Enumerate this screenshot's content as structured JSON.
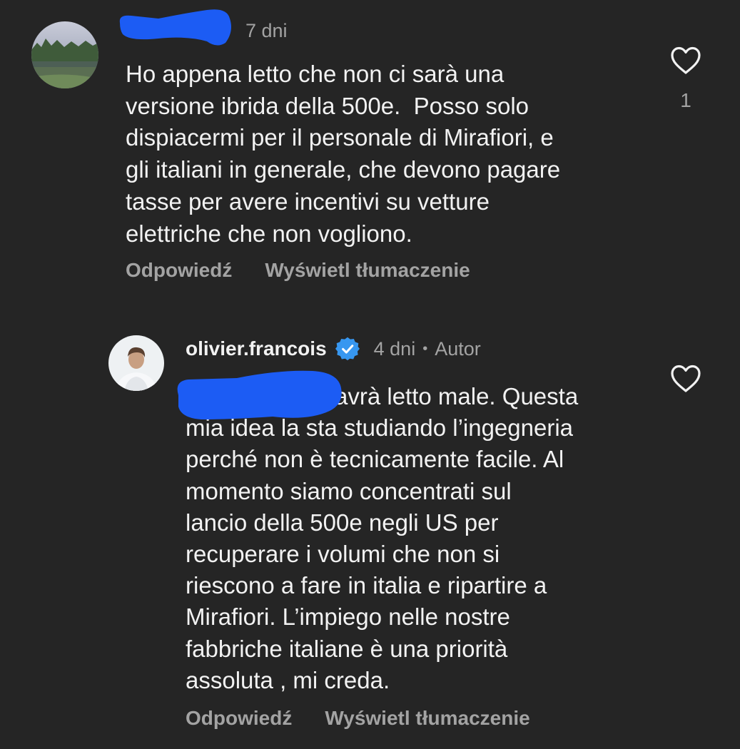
{
  "comments": [
    {
      "username": "",
      "time": "7 dni",
      "lines": [
        "Ho appena letto che non ci sarà una",
        "versione ibrida della 500e.  Posso solo",
        "dispiacermi per il personale di Mirafiori, e",
        "gli italiani in generale, che devono pagare",
        "tasse per avere incentivi su vetture",
        "elettriche che non vogliono."
      ],
      "like_count": "1",
      "actions": {
        "reply": "Odpowiedź",
        "translate": "Wyświetl tłumaczenie"
      },
      "icons": {
        "avatar": "landscape-avatar",
        "like": "heart-outline-icon"
      }
    },
    {
      "username": "olivier.francois",
      "verified": true,
      "time": "4 dni",
      "separator": "•",
      "author_label": "Autor",
      "lines": [
        "avrà letto male. Questa",
        "mia idea la sta studiando l’ingegneria",
        "perché non è tecnicamente facile. Al",
        "momento siamo concentrati sul",
        "lancio della 500e negli US per",
        "recuperare i volumi che non si",
        "riescono a fare in italia e ripartire a",
        "Mirafiori. L’impiego nelle nostre",
        "fabbriche italiane è una priorità",
        "assoluta , mi creda."
      ],
      "actions": {
        "reply": "Odpowiedź",
        "translate": "Wyświetl tłumaczenie"
      },
      "icons": {
        "avatar": "person-avatar",
        "verified": "verified-badge-icon",
        "like": "heart-outline-icon"
      }
    }
  ],
  "colors": {
    "background": "#252525",
    "text": "#f2f2f2",
    "secondary_text": "#a3a3a3",
    "verified_badge": "#3797f0",
    "redaction": "#1c5cf4"
  }
}
